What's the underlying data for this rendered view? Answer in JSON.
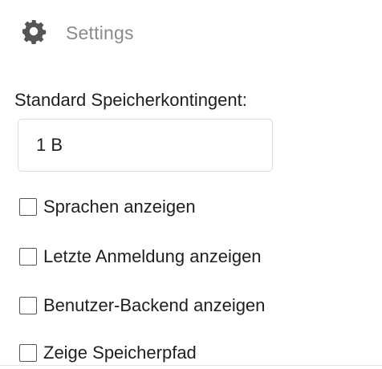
{
  "header": {
    "icon": "gear-icon",
    "title": "Settings"
  },
  "quota": {
    "label": "Standard Speicherkontingent:",
    "value": "1 B"
  },
  "options": [
    {
      "label": "Sprachen anzeigen",
      "checked": false
    },
    {
      "label": "Letzte Anmeldung anzeigen",
      "checked": false
    },
    {
      "label": "Benutzer-Backend anzeigen",
      "checked": false
    },
    {
      "label": "Zeige Speicherpfad",
      "checked": false
    }
  ],
  "colors": {
    "title_gray": "#8a8a8a",
    "icon_gray": "#555555",
    "input_border": "#dcdcdc"
  }
}
